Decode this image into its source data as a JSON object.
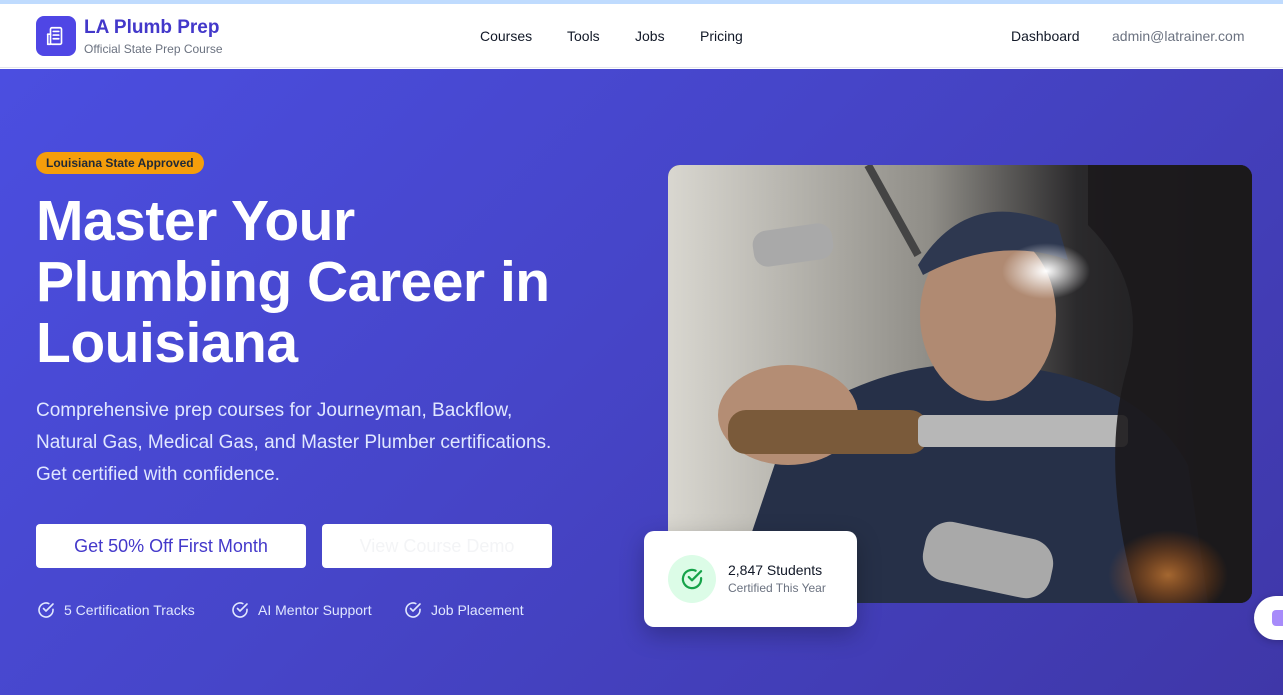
{
  "header": {
    "brand_title": "LA Plumb Prep",
    "brand_subtitle": "Official State Prep Course",
    "nav": [
      "Courses",
      "Tools",
      "Jobs",
      "Pricing"
    ],
    "dashboard_label": "Dashboard",
    "user_email": "admin@latrainer.com"
  },
  "hero": {
    "badge": "Louisiana State Approved",
    "title_lines": [
      "Master Your",
      "Plumbing Career in",
      "Louisiana"
    ],
    "description_lines": [
      "Comprehensive prep courses for Journeyman, Backflow,",
      "Natural Gas, Medical Gas, and Master Plumber certifications.",
      "Get certified with confidence."
    ],
    "primary_button": "Get 50% Off First Month",
    "secondary_button": "View Course Demo",
    "features": [
      "5 Certification Tracks",
      "AI Mentor Support",
      "Job Placement"
    ]
  },
  "stat_card": {
    "value": "2,847 Students",
    "label": "Certified This Year"
  },
  "icons": {
    "logo": "building-document-icon",
    "check": "check-circle-icon",
    "stat": "check-circle-icon",
    "chat": "chat-widget-icon"
  },
  "colors": {
    "brand": "#4f46e5",
    "badge": "#f59e0b",
    "hero_start": "#4b4ee0",
    "hero_end": "#3f37a8",
    "success": "#16a34a"
  }
}
